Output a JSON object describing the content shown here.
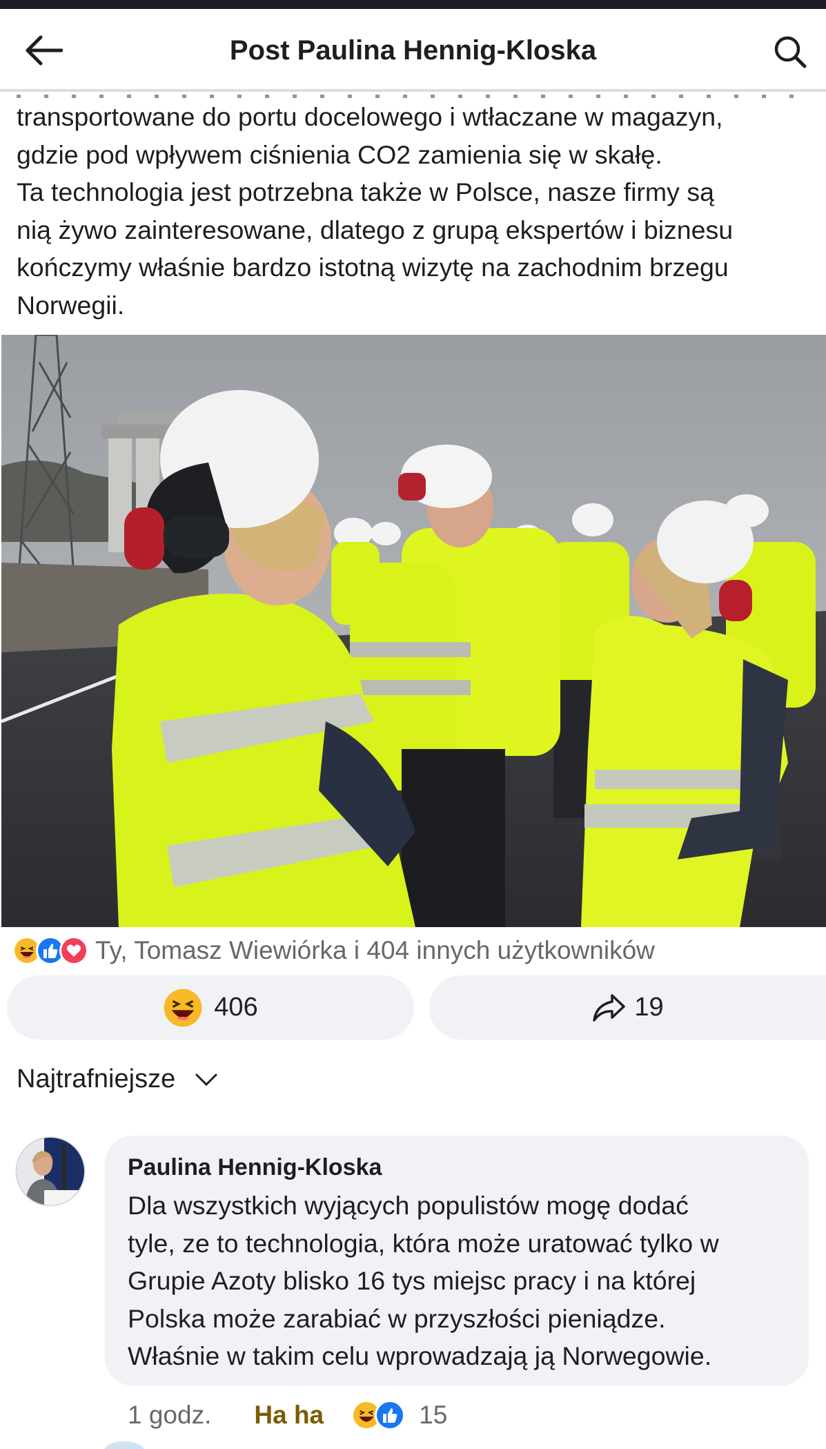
{
  "header": {
    "title": "Post Paulina Hennig-Kloska",
    "back_icon": "arrow-left-icon",
    "search_icon": "search-icon"
  },
  "post": {
    "text_lines": [
      "transportowane do portu docelowego i wtłaczane w magazyn,",
      "gdzie pod wpływem ciśnienia CO2 zamienia się w skałę.",
      "Ta technologia jest potrzebna także w Polsce, nasze firmy są",
      "nią żywo zainteresowane, dlatego z grupą ekspertów i biznesu",
      "kończymy właśnie bardzo istotną wizytę na zachodnim brzegu",
      "Norwegii."
    ],
    "photo_alt": "People in yellow high-visibility jackets and white helmets at an industrial site"
  },
  "reactions": {
    "icons": [
      "haha-icon",
      "like-icon",
      "love-icon"
    ],
    "summary": "Ty, Tomasz Wiewiórka i 404 innych użytkowników"
  },
  "actions": {
    "react_count": "406",
    "share_count": "19"
  },
  "sort": {
    "label": "Najtrafniejsze"
  },
  "comment": {
    "author": "Paulina Hennig-Kloska",
    "text_lines": [
      "Dla wszystkich wyjących populistów mogę dodać",
      "tyle, ze to technologia, która może uratować tylko w",
      "Grupie Azoty blisko 16 tys miejsc pracy i na której",
      "Polska może zarabiać w przyszłości pieniądze.",
      "Właśnie w takim celu wprowadzają ją Norwegowie."
    ],
    "time": "1 godz.",
    "reaction_label": "Ha ha",
    "reaction_count": "15"
  },
  "colors": {
    "header_border": "#dcdde0",
    "button_bg": "#f0f2f5",
    "secondary_text": "#65676b",
    "haha_gold": "#7a5c00",
    "like_blue": "#1877f2",
    "love_red": "#f33e58",
    "hivis_yellow": "#d9f21a"
  }
}
